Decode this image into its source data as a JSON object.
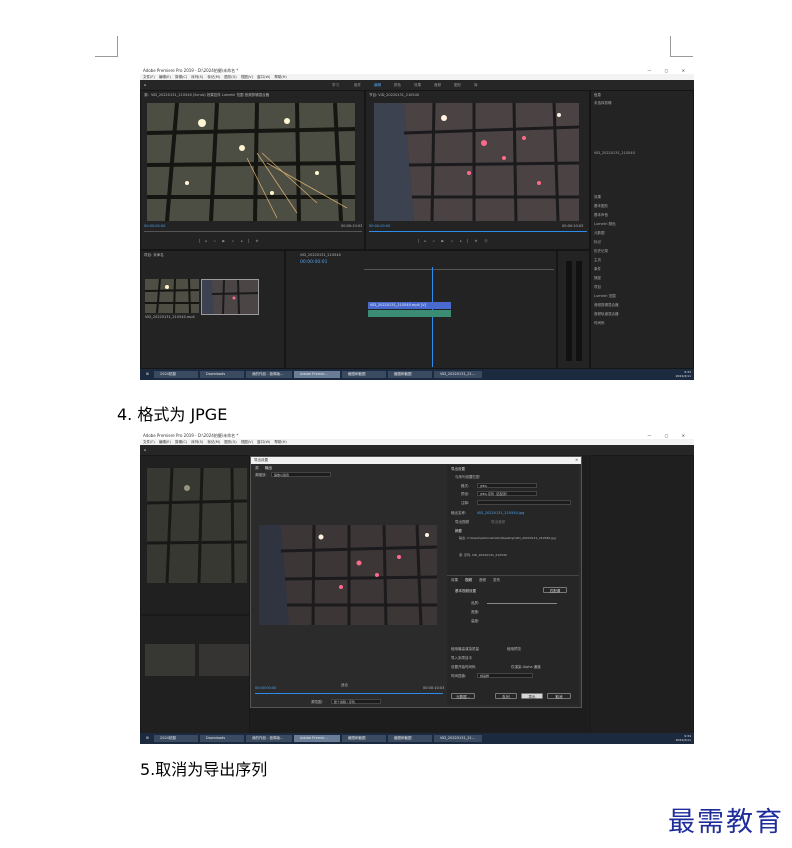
{
  "screenshot1": {
    "window_title": "Adobe Premiere Pro 2019 - D:\\2024拍摄\\未命名 *",
    "menu": [
      "文件(F)",
      "编辑(E)",
      "剪辑(C)",
      "序列(S)",
      "标记(M)",
      "图形(G)",
      "视图(V)",
      "窗口(W)",
      "帮助(H)"
    ],
    "workspaces": [
      "学习",
      "组件",
      "编辑",
      "颜色",
      "效果",
      "音频",
      "图形",
      "库"
    ],
    "source_tabs": "源：VID_20220131_210540 (Scrub)   效果控件   Lumetri 范围   音频剪辑混合器",
    "program_tab": "节目: VID_20220131_210540",
    "source_timecode": "00:00:00:00",
    "program_timecode": "00:00:00:00",
    "program_duration": "00:00:10:03",
    "source_duration": "00:00:10:03",
    "timeline_timecode": "00:00:00:01",
    "timeline_tab": "VID_20220131_210540",
    "project_tab": "项目: 未命名",
    "media_file": "VID_20220131_210540.mp4",
    "clip_name": "VID_20220131_210540.mp4 [V]",
    "right_panel_title": "信息",
    "right_panel_items": [
      "未选择剪辑",
      "VID_20220131_210540",
      "效果",
      "基本图形",
      "基本声音",
      "Lumetri 颜色",
      "元数据",
      "标记",
      "历史记录",
      "主页",
      "事件",
      "捕捉",
      "项目",
      "Lumetri 范围",
      "音频剪辑混合器",
      "音频轨道混合器",
      "时间码"
    ],
    "taskbar": [
      "2024拍摄",
      "Downloads",
      "我的作品 - 极简版...",
      "Adobe Premie...",
      "截图和截图",
      "截图和截图",
      "VID_20220131_21..."
    ],
    "tray_time": "9:33",
    "tray_date": "2022/2/11"
  },
  "caption1": "4. 格式为 JPGE",
  "screenshot2": {
    "window_title": "Adobe Premiere Pro 2019 - D:\\2024拍摄\\未命名 *",
    "dialog_title": "导出设置",
    "dialog_tabs": [
      "源",
      "输出"
    ],
    "source_scaling_label": "源缩放:",
    "source_scaling_value": "缩放以适合",
    "export_settings_header": "导出设置",
    "match_sequence": "与序列设置匹配",
    "format_label": "格式:",
    "format_value": "JPEG",
    "preset_label": "预设:",
    "preset_value": "JPEG 序列（匹配源）",
    "comments_label": "注释:",
    "output_name_label": "输出名称:",
    "output_name_value": "VID_20220131_210540.jpg",
    "export_video": "导出视频",
    "export_audio": "导出音频",
    "summary_header": "摘要",
    "summary_output": "输出: C:\\Users\\Administrator\\Desktop\\VID_20220131_210540.jpg",
    "summary_source": "源: 序列, VID_20220131_210540",
    "bottom_tabs": [
      "效果",
      "视频",
      "音频",
      "发布"
    ],
    "basic_settings": "基本视频设置",
    "match_source_button": "匹配源",
    "quality_label": "品质:",
    "width_label": "宽度:",
    "height_label": "高度:",
    "render_max_depth": "使用最高渲染质量",
    "use_previews": "使用预览",
    "import_to_project": "导入到项目中",
    "set_start_timecode": "设置开始时间码",
    "render_alpha": "仅渲染 Alpha 通道",
    "time_interpolation_label": "时间插值:",
    "time_interpolation_value": "帧采样",
    "timecode_left": "00:00:00:00",
    "timecode_right": "00:00:10:03",
    "fit_label": "适合",
    "source_range_label": "源范围:",
    "source_range_value": "整个剪辑 / 序列",
    "buttons": [
      "元数据...",
      "队列",
      "导出",
      "取消"
    ],
    "taskbar": [
      "2024拍摄",
      "Downloads",
      "我的作品 - 极简版...",
      "Adobe Premie...",
      "截图和截图",
      "截图和截图",
      "VID_20220131_21..."
    ],
    "tray_time": "9:34",
    "tray_date": "2022/2/11"
  },
  "caption2": "5.取消为导出序列",
  "logo": "最需教育",
  "colors": {
    "accent": "#2d8ceb",
    "logo": "#1f2d9c",
    "panel": "#232323"
  }
}
